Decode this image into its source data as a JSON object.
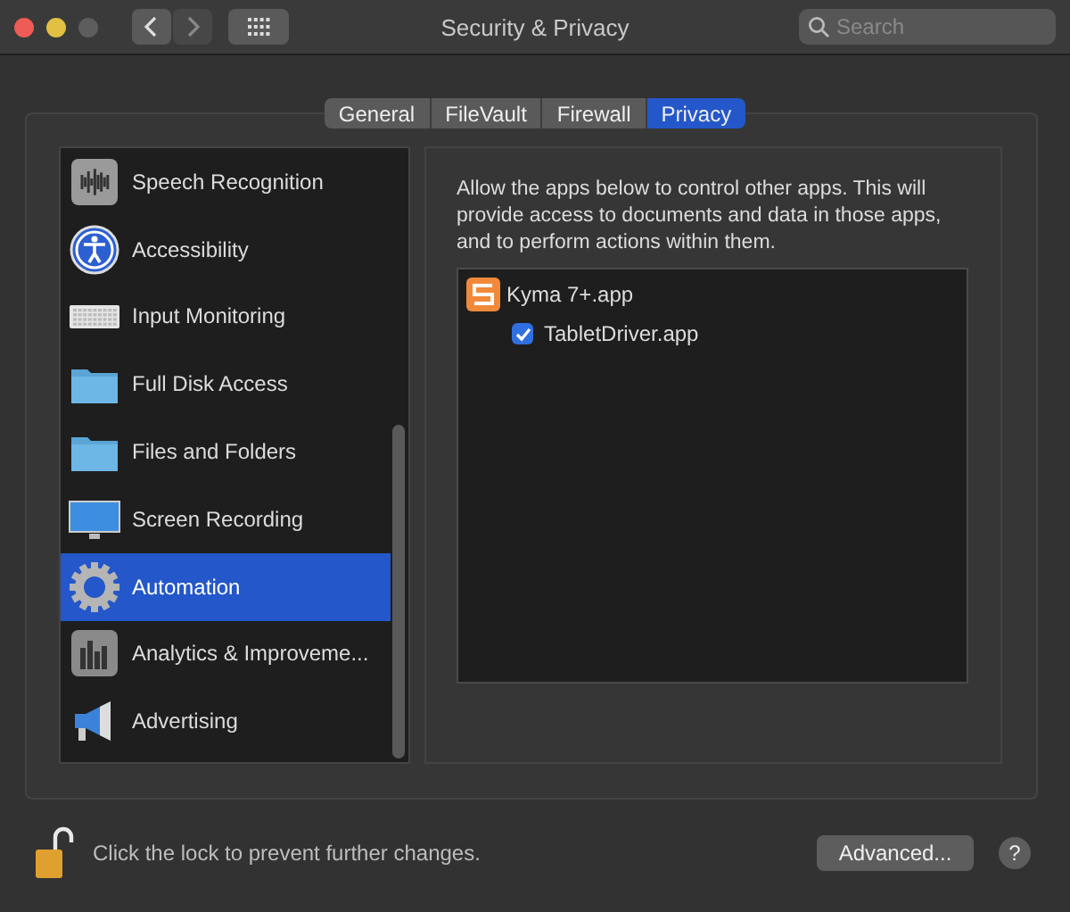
{
  "window": {
    "title": "Security & Privacy",
    "search": {
      "placeholder": "Search"
    }
  },
  "tabs": [
    {
      "label": "General",
      "selected": false
    },
    {
      "label": "FileVault",
      "selected": false
    },
    {
      "label": "Firewall",
      "selected": false
    },
    {
      "label": "Privacy",
      "selected": true
    }
  ],
  "sidebar": {
    "items": [
      {
        "label": "Speech Recognition",
        "kind": "speech",
        "selected": false
      },
      {
        "label": "Accessibility",
        "kind": "accessibility",
        "selected": false
      },
      {
        "label": "Input Monitoring",
        "kind": "keyboard",
        "selected": false
      },
      {
        "label": "Full Disk Access",
        "kind": "folder",
        "selected": false
      },
      {
        "label": "Files and Folders",
        "kind": "folder",
        "selected": false
      },
      {
        "label": "Screen Recording",
        "kind": "display",
        "selected": false
      },
      {
        "label": "Automation",
        "kind": "gear",
        "selected": true
      },
      {
        "label": "Analytics & Improveme...",
        "kind": "chart",
        "selected": false
      },
      {
        "label": "Advertising",
        "kind": "megaphone",
        "selected": false
      }
    ]
  },
  "detail": {
    "description": "Allow the apps below to control other apps. This will provide access to documents and data in those apps, and to perform actions within them.",
    "apps": [
      {
        "name": "Kyma 7+.app",
        "children": [
          {
            "name": "TabletDriver.app",
            "checked": true
          }
        ]
      }
    ]
  },
  "footer": {
    "lock_text": "Click the lock to prevent further changes.",
    "advanced_button": "Advanced...",
    "help_button": "?"
  }
}
